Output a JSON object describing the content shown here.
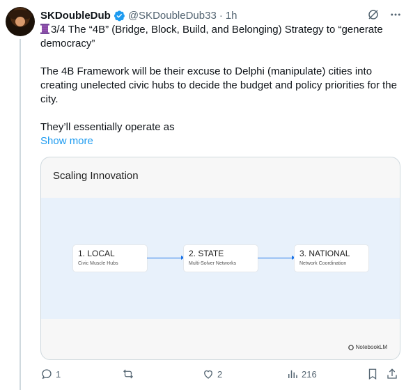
{
  "author": {
    "display_name": "SKDoubleDub",
    "handle": "@SKDoubleDub33",
    "separator": "·",
    "time": "1h"
  },
  "post": {
    "line1": "3/4 The “4B” (Bridge, Block, Build, and Belonging) Strategy to “generate democracy”",
    "line2": "The 4B Framework will be their excuse to Delphi (manipulate) cities into creating unelected civic hubs to decide the budget and policy priorities for the city.",
    "line3": "They’ll essentially operate as",
    "show_more": "Show more"
  },
  "media": {
    "title": "Scaling Innovation",
    "steps": [
      {
        "title": "1. LOCAL",
        "sub": "Civic Muscle Hubs"
      },
      {
        "title": "2. STATE",
        "sub": "Multi-Solver Networks"
      },
      {
        "title": "3. NATIONAL",
        "sub": "Network Coordination"
      }
    ],
    "watermark": "NotebookLM"
  },
  "actions": {
    "replies": "1",
    "reposts": "",
    "likes": "2",
    "views": "216"
  },
  "colors": {
    "accent": "#1d9bf0",
    "muted": "#536471",
    "verified": "#1d9bf0",
    "diagram_arrow": "#1a73e8"
  },
  "icons": [
    "spool-icon",
    "verified-icon",
    "grok-icon",
    "more-icon",
    "reply-icon",
    "repost-icon",
    "like-icon",
    "views-icon",
    "bookmark-icon",
    "share-icon"
  ]
}
